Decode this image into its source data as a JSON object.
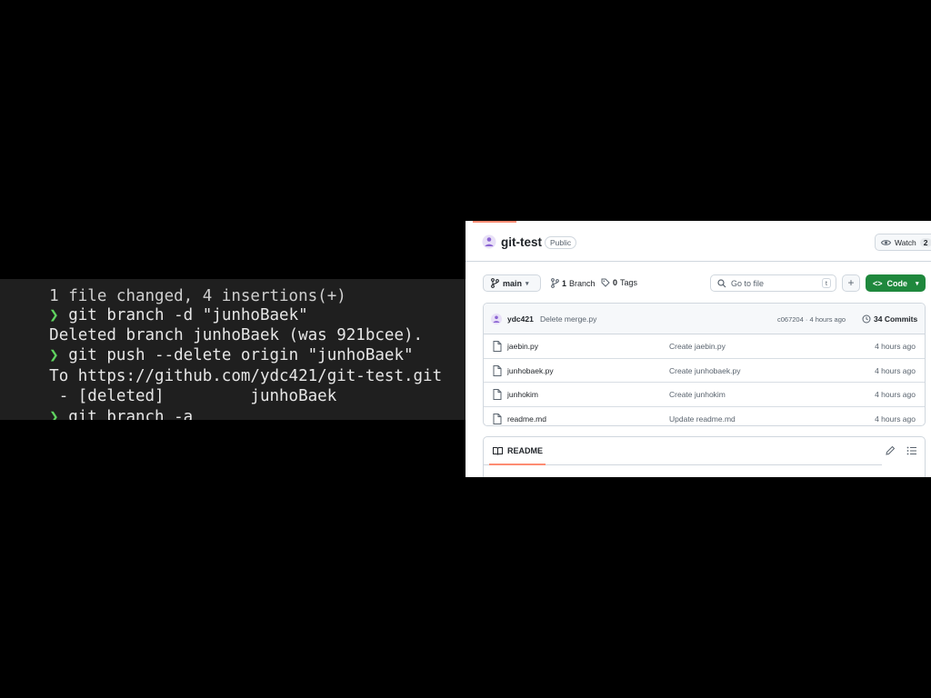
{
  "terminal": {
    "lines": [
      {
        "prompt": "",
        "text": "1 file changed, 4 insertions(+)"
      },
      {
        "prompt": "❯",
        "text": " git branch -d \"junhoBaek\""
      },
      {
        "prompt": "",
        "text": "Deleted branch junhoBaek (was 921bcee)."
      },
      {
        "prompt": "❯",
        "text": " git push --delete origin \"junhoBaek\""
      },
      {
        "prompt": "",
        "text": "To https://github.com/ydc421/git-test.git"
      },
      {
        "prompt": "",
        "text": " - [deleted]         junhoBaek"
      },
      {
        "prompt": "❯",
        "text": " git branch -a"
      }
    ]
  },
  "repo": {
    "name": "git-test",
    "visibility": "Public",
    "watch_label": "Watch",
    "watch_count": "2",
    "branch": "main",
    "branch_count": "1",
    "branch_label": "Branch",
    "tag_count": "0",
    "tag_label": "Tags",
    "search_placeholder": "Go to file",
    "search_kbd": "t",
    "plus_label": "+",
    "code_label": "Code"
  },
  "commit": {
    "user": "ydc421",
    "message": "Delete merge.py",
    "hash_time": "c067204 · 4 hours ago",
    "commit_count": "34 Commits"
  },
  "files": [
    {
      "name": "jaebin.py",
      "commit": "Create jaebin.py",
      "time": "4 hours ago"
    },
    {
      "name": "junhobaek.py",
      "commit": "Create junhobaek.py",
      "time": "4 hours ago"
    },
    {
      "name": "junhokim",
      "commit": "Create junhokim",
      "time": "4 hours ago"
    },
    {
      "name": "readme.md",
      "commit": "Update readme.md",
      "time": "4 hours ago"
    }
  ],
  "readme": {
    "title": "README"
  },
  "colors": {
    "terminal_bg": "#1f1f1f",
    "prompt": "#5fd35f",
    "code_button": "#1f883d",
    "tab_accent": "#fd8c73"
  }
}
